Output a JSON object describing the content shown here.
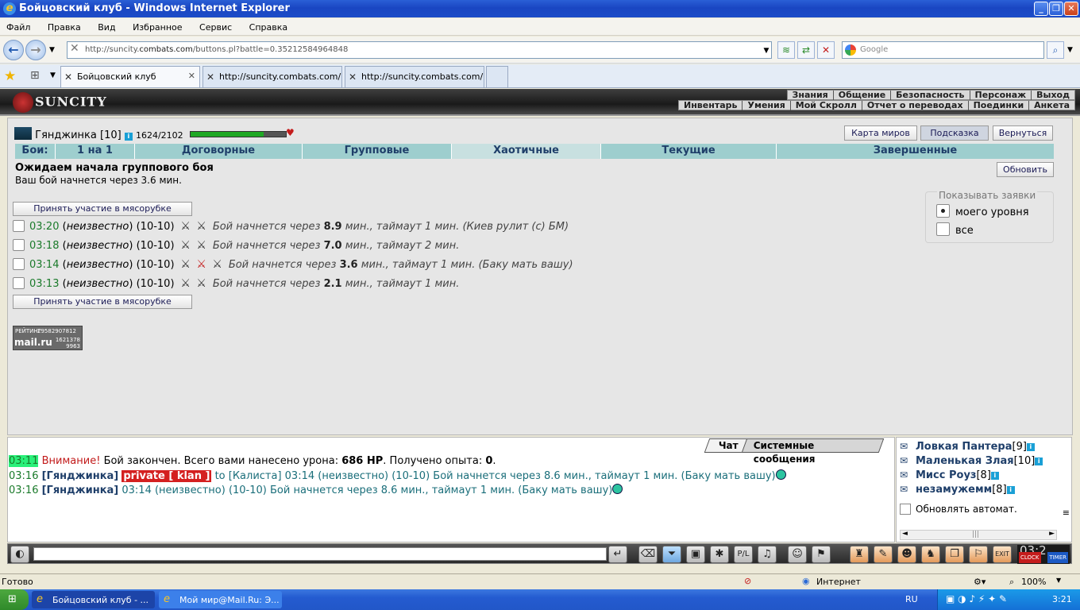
{
  "window": {
    "title": "Бойцовский клуб - Windows Internet Explorer"
  },
  "menu": [
    "Файл",
    "Правка",
    "Вид",
    "Избранное",
    "Сервис",
    "Справка"
  ],
  "address": {
    "prefix": "http://suncity.",
    "domain": "combats.com",
    "suffix": "/buttons.pl?battle=0.35212584964848"
  },
  "search": {
    "placeholder": "Google"
  },
  "tabs": [
    {
      "label": "Бойцовский клуб"
    },
    {
      "label": "http://suncity.combats.com/..."
    },
    {
      "label": "http://suncity.combats.com/l..."
    }
  ],
  "header": {
    "logo": "SUNCITY",
    "nav_top": [
      "Знания",
      "Общение",
      "Безопасность",
      "Персонаж",
      "Выход"
    ],
    "nav_bottom": [
      "Инвентарь",
      "Умения",
      "Мой Скролл",
      "Отчет о переводах",
      "Поединки",
      "Анкета"
    ]
  },
  "character": {
    "name": "Гянджинка",
    "level": "[10]",
    "hp": "1624/2102",
    "hp_fraction": 0.77
  },
  "buttons": {
    "map": "Карта миров",
    "hint": "Подсказка",
    "back": "Вернуться",
    "refresh": "Обновить",
    "join": "Принять участие в мясорубке"
  },
  "fight_tabs": {
    "label": "Бои:",
    "items": [
      "1 на 1",
      "Договорные",
      "Групповые",
      "Хаотичные",
      "Текущие",
      "Завершенные"
    ],
    "active": 3
  },
  "waiting": {
    "title": "Ожидаем начала группового боя",
    "subtitle": "Ваш бой начнется через 3.6 мин."
  },
  "show_requests": {
    "legend": "Показывать заявки",
    "options": [
      "моего уровня",
      "все"
    ],
    "selected": 0
  },
  "requests": [
    {
      "time": "03:20",
      "who": "неизвестно",
      "range": "(10-10)",
      "pre": "Бой начнется через",
      "min": "8.9",
      "post": "мин., таймаут 1 мин. (Киев рулит (с) БМ)"
    },
    {
      "time": "03:18",
      "who": "неизвестно",
      "range": "(10-10)",
      "pre": "Бой начнется через",
      "min": "7.0",
      "post": "мин., таймаут 2 мин."
    },
    {
      "time": "03:14",
      "who": "неизвестно",
      "range": "(10-10)",
      "pre": "Бой начнется через",
      "min": "3.6",
      "post": "мин., таймаут 1 мин. (Баку мать вашу)"
    },
    {
      "time": "03:13",
      "who": "неизвестно",
      "range": "(10-10)",
      "pre": "Бой начнется через",
      "min": "2.1",
      "post": "мин., таймаут 1 мин."
    }
  ],
  "counter": {
    "label": "РЕЙТИНГ",
    "top": "29582907812",
    "brand": "mail.ru",
    "v1": "1621378",
    "v2": "9963"
  },
  "chat_tabs": [
    "Чат",
    "Системные сообщения"
  ],
  "chat": {
    "l1": {
      "time": "03:11",
      "warn": "Внимание!",
      "text": "Бой закончен. Всего вами нанесено урона:",
      "dmg": "686 HP",
      "text2": ". Получено опыта:",
      "exp": "0",
      "end": "."
    },
    "l2": {
      "time": "03:16",
      "nick": "[Гянджинка]",
      "priv": "private [ klan ]",
      "to": "to [Калиста] 03:14 (неизвестно) (10-10) Бой начнется через 8.6 мин., таймаут 1 мин. (Баку мать вашу)"
    },
    "l3": {
      "time": "03:16",
      "nick": "[Гянджинка]",
      "text": "03:14 (неизвестно) (10-10) Бой начнется через 8.6 мин., таймаут 1 мин. (Баку мать вашу)"
    }
  },
  "users": [
    {
      "name": "Ловкая Пантера",
      "level": "[9]"
    },
    {
      "name": "Маленькая Злая",
      "level": "[10]"
    },
    {
      "name": "Мисс Роуз",
      "level": "[8]"
    },
    {
      "name": "незамужемм",
      "level": "[8]"
    }
  ],
  "auto_refresh": "Обновлять автомат.",
  "clock": {
    "time": "03:2",
    "a": "CLOCK",
    "b": "TIMER"
  },
  "status": {
    "ready": "Готово",
    "zone": "Интернет",
    "zoom": "100%"
  },
  "taskbar": {
    "t1": "Бойцовский клуб - ...",
    "t2": "Мой мир@Mail.Ru: Э...",
    "lang": "RU",
    "time": "3:21"
  }
}
